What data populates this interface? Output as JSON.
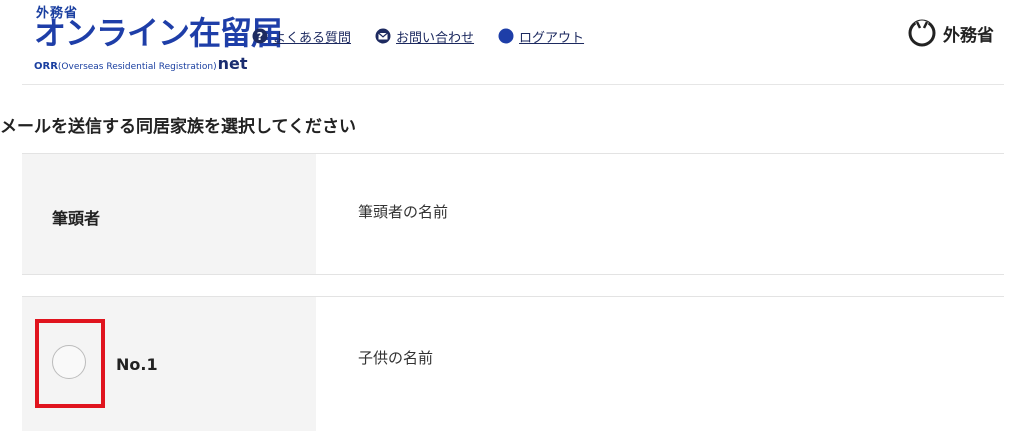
{
  "header": {
    "logo": {
      "ministry": "外務省",
      "main": "オンライン在留届",
      "sub_abbr": "ORR",
      "sub_full": "Overseas Residential Registration",
      "sub_net": "net"
    },
    "nav": [
      {
        "label": "よくある質問",
        "icon": "question-icon"
      },
      {
        "label": "お問い合わせ",
        "icon": "mail-icon"
      },
      {
        "label": "ログアウト",
        "icon": "logout-dot-icon"
      }
    ],
    "brand": {
      "label": "外務省",
      "icon": "ministry-emblem-icon"
    }
  },
  "page": {
    "title": "メールを送信する同居家族を選択してください"
  },
  "rows": [
    {
      "label": "筆頭者",
      "value": "筆頭者の名前"
    },
    {
      "label": "No.1",
      "value": "子供の名前",
      "selected": false
    }
  ],
  "colors": {
    "brand_blue": "#1e3ea8",
    "link_navy": "#1d2a60",
    "highlight_red": "#e0141e"
  }
}
